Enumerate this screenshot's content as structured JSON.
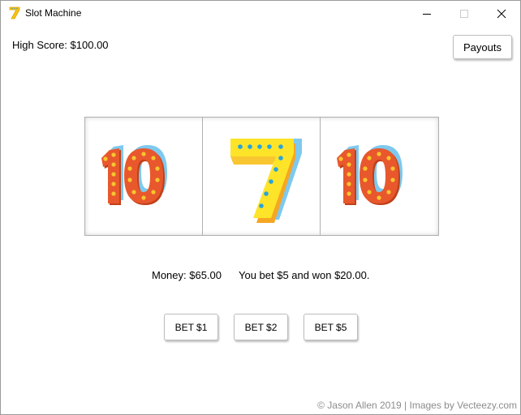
{
  "window": {
    "title": "Slot Machine",
    "icon": "seven-icon"
  },
  "header": {
    "high_score_label": "High Score: $100.00",
    "payouts_label": "Payouts"
  },
  "reels": [
    {
      "symbol": "ten",
      "label": "10"
    },
    {
      "symbol": "seven",
      "label": "7"
    },
    {
      "symbol": "ten",
      "label": "10"
    }
  ],
  "status": {
    "money": "Money: $65.00",
    "result": "You bet $5 and won $20.00."
  },
  "bets": [
    {
      "label": "BET $1"
    },
    {
      "label": "BET $2"
    },
    {
      "label": "BET $5"
    }
  ],
  "footer": {
    "credit": "© Jason Allen 2019 | Images by Vecteezy.com"
  },
  "colors": {
    "ten_orange": "#e8582c",
    "ten_shadow": "#7ec9ee",
    "bulb_yellow": "#f7c531",
    "seven_yellow": "#fde428",
    "seven_orange": "#f5a623",
    "seven_blue": "#7ec9ee",
    "seven_dot": "#29a3dc"
  }
}
